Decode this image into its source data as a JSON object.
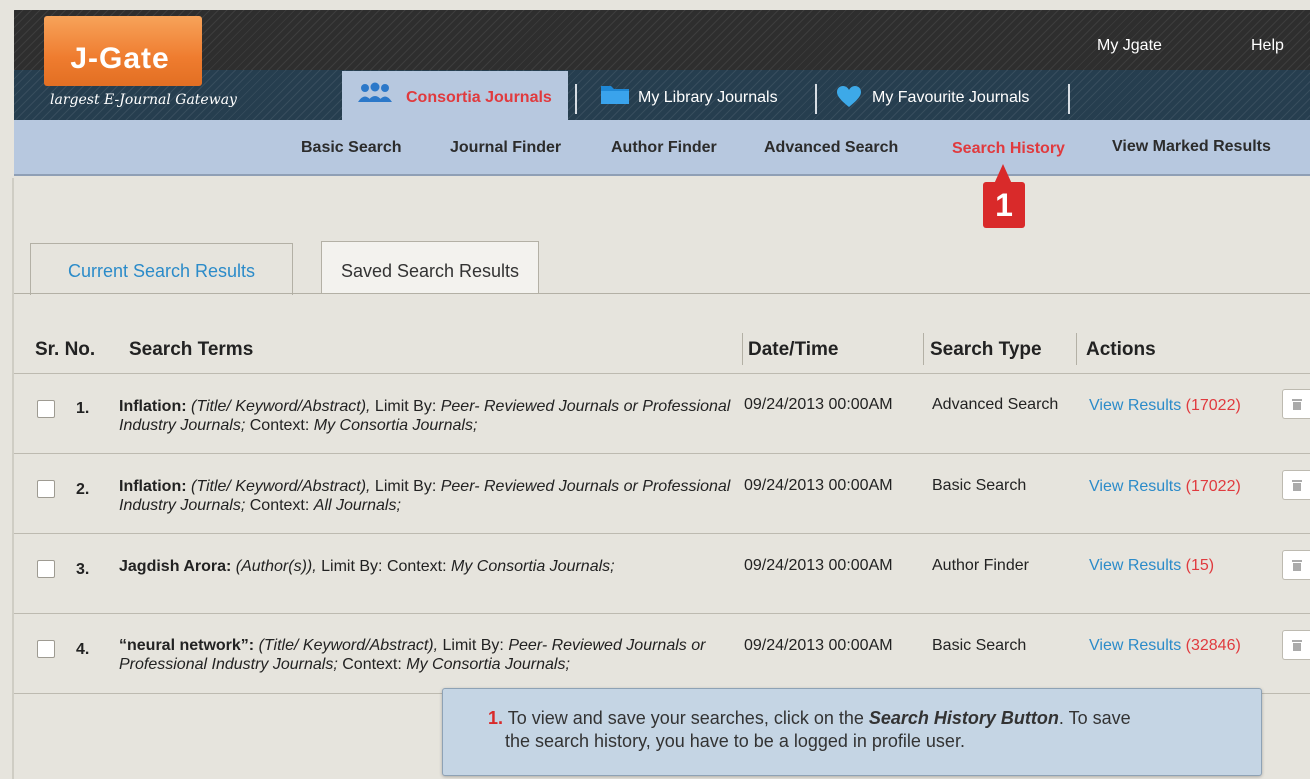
{
  "header": {
    "logo_text": "J-Gate",
    "tagline": "largest E-Journal Gateway",
    "links": {
      "my_jgate": "My Jgate",
      "help": "Help"
    },
    "tabs": [
      {
        "label": "Consortia Journals",
        "icon": "people-icon"
      },
      {
        "label": "My Library Journals",
        "icon": "folder-icon"
      },
      {
        "label": "My Favourite Journals",
        "icon": "heart-icon"
      }
    ]
  },
  "subnav": {
    "items": [
      "Basic Search",
      "Journal Finder",
      "Author Finder",
      "Advanced Search",
      "Search History",
      "View Marked Results"
    ],
    "active_index": 4
  },
  "marker": {
    "label": "1"
  },
  "results_tabs": {
    "current": "Current Search Results",
    "saved": "Saved Search Results"
  },
  "table": {
    "headers": {
      "sr_no": "Sr. No.",
      "terms": "Search Terms",
      "datetime": "Date/Time",
      "type": "Search Type",
      "actions": "Actions"
    },
    "rows": [
      {
        "num": "1.",
        "term": "Inflation:",
        "fields": "(Title/ Keyword/Abstract),",
        "limit_label": "Limit By:",
        "limit_value": "Peer- Reviewed Journals or Professional Industry Journals;",
        "context_label": "Context:",
        "context_value": "My Consortia Journals;",
        "datetime": "09/24/2013 00:00AM",
        "type": "Advanced Search",
        "view_label": "View Results",
        "count": "(17022)"
      },
      {
        "num": "2.",
        "term": "Inflation:",
        "fields": "(Title/ Keyword/Abstract),",
        "limit_label": "Limit By:",
        "limit_value": "Peer- Reviewed Journals or Professional Industry Journals;",
        "context_label": "Context:",
        "context_value": "All Journals;",
        "datetime": "09/24/2013 00:00AM",
        "type": "Basic Search",
        "view_label": "View Results",
        "count": "(17022)"
      },
      {
        "num": "3.",
        "term": "Jagdish Arora:",
        "fields": "(Author(s)),",
        "limit_label": "Limit By:",
        "limit_value": "",
        "context_label": "Context:",
        "context_value": "My Consortia Journals;",
        "datetime": "09/24/2013 00:00AM",
        "type": "Author Finder",
        "view_label": "View Results",
        "count": "(15)"
      },
      {
        "num": "4.",
        "term": "“neural network”:",
        "fields": "(Title/ Keyword/Abstract),",
        "limit_label": "Limit By:",
        "limit_value": "Peer- Reviewed Journals or Professional Industry Journals;",
        "context_label": "Context:",
        "context_value": "My Consortia Journals;",
        "datetime": "09/24/2013 00:00AM",
        "type": "Basic Search",
        "view_label": "View Results",
        "count": "(32846)"
      }
    ]
  },
  "tooltip": {
    "num": "1.",
    "text1": " To view and save your searches, click on the ",
    "bold": "Search History Button",
    "text2": ". To save",
    "line2": "the search history, you have to be a logged in profile user."
  },
  "colors": {
    "accent_red": "#e03a3e",
    "link_blue": "#2b8bc9",
    "logo_orange": "#ef7c2f",
    "nav_blue": "#b7c8df"
  }
}
